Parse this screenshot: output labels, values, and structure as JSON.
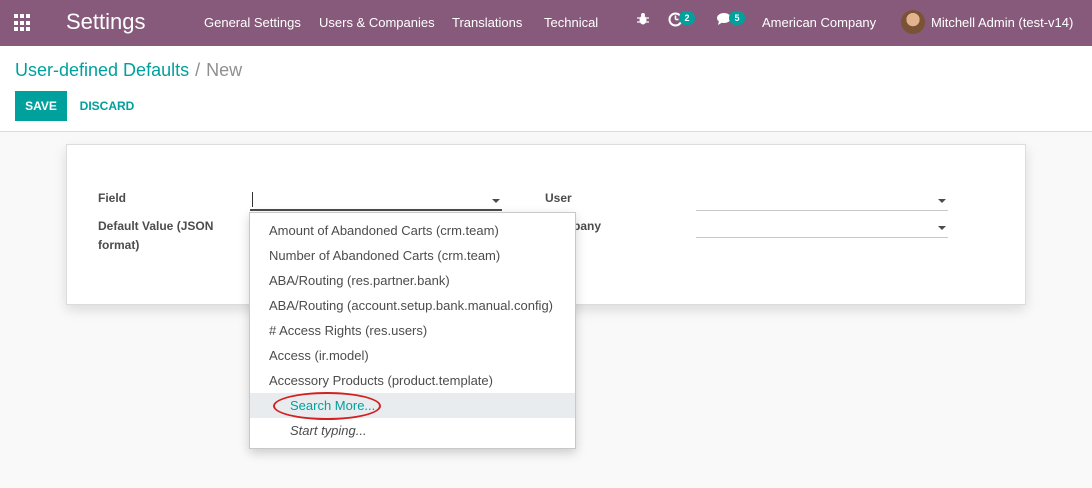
{
  "navbar": {
    "brand": "Settings",
    "menu": [
      "General Settings",
      "Users & Companies",
      "Translations",
      "Technical"
    ],
    "activities_badge": "2",
    "messages_badge": "5",
    "company": "American Company",
    "user": "Mitchell Admin (test-v14)"
  },
  "breadcrumb": {
    "parent": "User-defined Defaults",
    "separator": "/",
    "current": "New"
  },
  "buttons": {
    "save": "SAVE",
    "discard": "DISCARD"
  },
  "form": {
    "field_label": "Field",
    "field_value": "",
    "default_value_label_1": "Default Value (JSON",
    "default_value_label_2": "format)",
    "user_label": "User",
    "company_label_visible": "pany"
  },
  "dropdown": {
    "items": [
      "Amount of Abandoned Carts (crm.team)",
      "Number of Abandoned Carts (crm.team)",
      "ABA/Routing (res.partner.bank)",
      "ABA/Routing (account.setup.bank.manual.config)",
      "# Access Rights (res.users)",
      "Access (ir.model)",
      "Accessory Products (product.template)"
    ],
    "search_more": "Search More...",
    "hint": "Start typing..."
  },
  "colors": {
    "navbar": "#875a7b",
    "accent": "#00a09d",
    "annotation": "#d42020"
  }
}
